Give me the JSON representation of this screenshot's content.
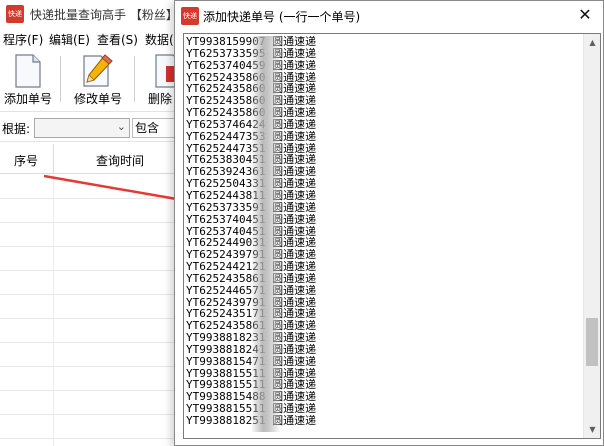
{
  "main_window": {
    "logo_text": "快递",
    "title": "快递批量查询高手 【粉丝】",
    "menu": [
      "程序(F)",
      "编辑(E)",
      "查看(S)",
      "数据("
    ],
    "toolbar": {
      "add_label": "添加单号",
      "edit_label": "修改单号",
      "delete_label": "删除"
    },
    "filter": {
      "label": "根据:",
      "select_value": "",
      "button_label": "包含"
    },
    "columns": [
      "序号",
      "查询时间"
    ]
  },
  "dialog": {
    "logo_text": "快递",
    "title": "添加快递单号 (一行一个单号)",
    "close_symbol": "✕",
    "lines": [
      "YT9938159907",
      "YT6253733595",
      "YT6253740459",
      "YT6252435860",
      "YT6252435860",
      "YT6252435860",
      "YT6252435860",
      "YT6253746424",
      "YT6252447353",
      "YT6252447351",
      "YT6253830451",
      "YT6253924361",
      "YT6252504331",
      "YT6252443811",
      "YT6253733591",
      "YT6253740451",
      "YT6253740451",
      "YT6252449031",
      "YT6252439791",
      "YT6252442121",
      "YT6252435861",
      "YT6252446571",
      "YT6252439791",
      "YT6252435171",
      "YT6252435861",
      "YT9938818231",
      "YT9938818241",
      "YT9938815471",
      "YT9938815511",
      "YT9938815511",
      "YT9938815488",
      "YT9938815511",
      "YT9938818251"
    ],
    "courier": "圆通速递",
    "scroll_position": 0.83
  },
  "colors": {
    "logo_red": "#d33a2c",
    "arrow_red": "#e53935"
  }
}
